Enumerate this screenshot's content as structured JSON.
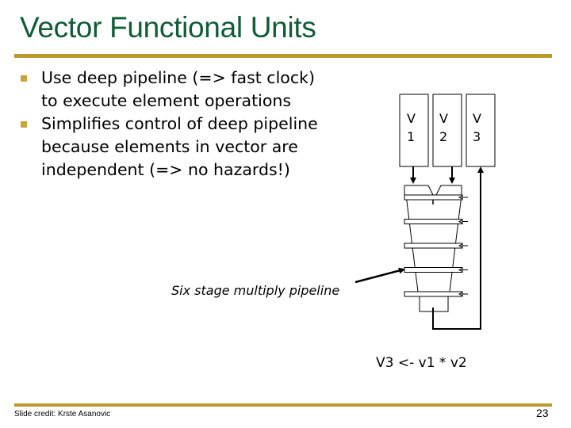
{
  "slide": {
    "title": "Vector Functional Units",
    "bullets": [
      {
        "text": "Use deep pipeline (=> fast clock) to execute element operations"
      },
      {
        "text": "Simplifies control of deep pipeline because elements in vector are independent (=> no hazards!)"
      }
    ],
    "diagram": {
      "registers": [
        {
          "letter": "V",
          "number": "1"
        },
        {
          "letter": "V",
          "number": "2"
        },
        {
          "letter": "V",
          "number": "3"
        }
      ],
      "caption": "Six stage multiply pipeline",
      "equation": "V3 <- v1 * v2",
      "pipeline_stages": 6
    },
    "footer": {
      "credit": "Slide credit: Krste Asanovic",
      "page_number": "23"
    },
    "colors": {
      "title": "#0f5c35",
      "rule": "#b99a2e",
      "bullet": "#c9a437"
    }
  }
}
